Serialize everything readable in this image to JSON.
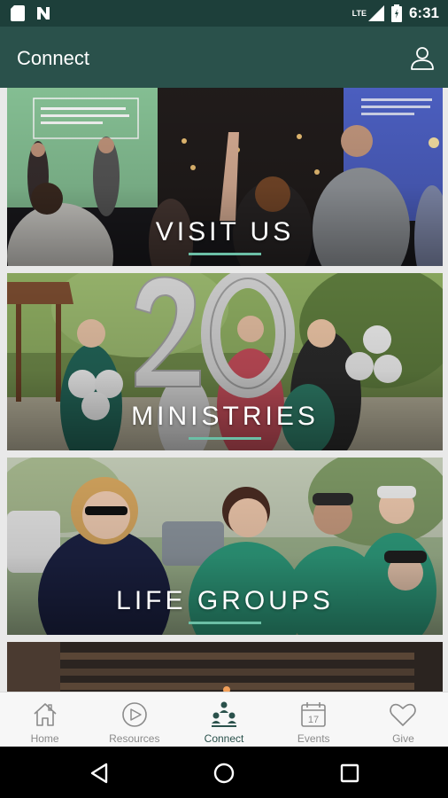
{
  "status_bar": {
    "time": "6:31",
    "network": "LTE"
  },
  "app_bar": {
    "title": "Connect",
    "profile_icon": "person-outline-icon"
  },
  "cards": [
    {
      "label": "VISIT US"
    },
    {
      "label": "MINISTRIES"
    },
    {
      "label": "LIFE GROUPS"
    },
    {
      "label": ""
    }
  ],
  "bottom_nav": {
    "items": [
      {
        "label": "Home",
        "icon": "home-icon"
      },
      {
        "label": "Resources",
        "icon": "play-circle-icon"
      },
      {
        "label": "Connect",
        "icon": "people-icon",
        "active": true
      },
      {
        "label": "Events",
        "icon": "calendar-icon",
        "day": "17"
      },
      {
        "label": "Give",
        "icon": "heart-icon"
      }
    ]
  },
  "colors": {
    "primary": "#2a514b",
    "status_bar": "#1d3f3a",
    "accent": "#6bbfa6"
  }
}
